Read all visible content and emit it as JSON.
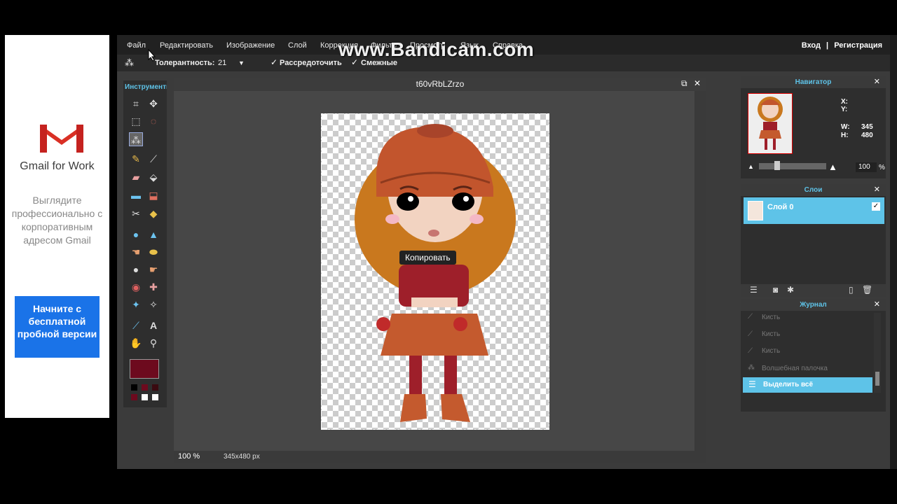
{
  "watermark": "www.Bandicam.com",
  "ad": {
    "brand": "Gmail for Work",
    "text": "Выглядите профессионально с корпоративным адресом Gmail",
    "cta": "Начните с бесплатной пробной версии"
  },
  "menu": {
    "file": "Файл",
    "edit": "Редактировать",
    "image": "Изображение",
    "layer": "Слой",
    "adjust": "Коррекция",
    "filter": "Фильтр",
    "view": "Просмотр",
    "language": "Язык",
    "help": "Справка",
    "login": "Вход",
    "sep": "|",
    "register": "Регистрация"
  },
  "options": {
    "tolerance_label": "Толерантность:",
    "tolerance_value": "21",
    "antialias_label": "Рассредоточить",
    "contiguous_label": "Смежные",
    "antialias_checked": true,
    "contiguous_checked": true
  },
  "tools": {
    "title": "Инструменты",
    "active": "magic-wand",
    "foreground_color": "#6d0a1e"
  },
  "canvas": {
    "title": "t60vRbLZrzo",
    "tooltip": "Копировать",
    "zoom": "100",
    "zoom_unit": "%",
    "size": "345x480 px"
  },
  "navigator": {
    "title": "Навигатор",
    "x_label": "X:",
    "y_label": "Y:",
    "w_label": "W:",
    "h_label": "H:",
    "w_value": "345",
    "h_value": "480",
    "zoom_value": "100",
    "zoom_unit": "%"
  },
  "layers": {
    "title": "Слои",
    "items": [
      {
        "name": "Слой 0",
        "visible": true
      }
    ]
  },
  "history": {
    "title": "Журнал",
    "items": [
      "Кисть",
      "Кисть",
      "Кисть",
      "Волшебная палочка"
    ],
    "active": "Выделить всё"
  }
}
